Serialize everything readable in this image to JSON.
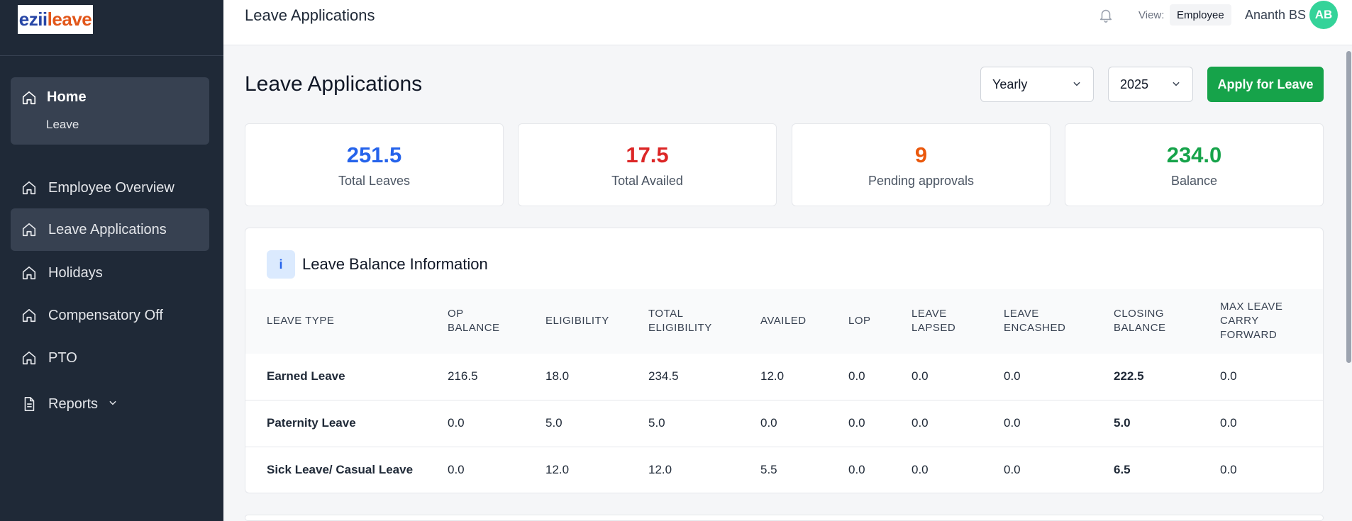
{
  "brand": {
    "logo_part1": "ezii",
    "logo_part2": "leave"
  },
  "sidebar": {
    "home": {
      "label": "Home",
      "sub": "Leave"
    },
    "items": [
      {
        "label": "Employee Overview",
        "icon": "home-icon"
      },
      {
        "label": "Leave Applications",
        "icon": "home-icon",
        "active": true
      },
      {
        "label": "Holidays",
        "icon": "home-icon"
      },
      {
        "label": "Compensatory Off",
        "icon": "home-icon"
      },
      {
        "label": "PTO",
        "icon": "home-icon"
      },
      {
        "label": "Reports",
        "icon": "document-icon"
      }
    ]
  },
  "topbar": {
    "title": "Leave Applications",
    "view_label": "View:",
    "view_value": "Employee",
    "user_name": "Ananth BS",
    "avatar_initials": "AB"
  },
  "main": {
    "title": "Leave Applications",
    "period_select": "Yearly",
    "year_select": "2025",
    "apply_button": "Apply for Leave"
  },
  "stats": [
    {
      "value": "251.5",
      "label": "Total Leaves",
      "color": "#2563eb"
    },
    {
      "value": "17.5",
      "label": "Total Availed",
      "color": "#dc2626"
    },
    {
      "value": "9",
      "label": "Pending approvals",
      "color": "#ea580c"
    },
    {
      "value": "234.0",
      "label": "Balance",
      "color": "#16a34a"
    }
  ],
  "balance": {
    "icon_text": "i",
    "title": "Leave Balance Information",
    "headers": {
      "leave_type": "Leave Type",
      "op_balance": "OP Balance",
      "eligibility": "Eligibility",
      "total_eligibility": "Total Eligibility",
      "availed": "Availed",
      "lop": "LOP",
      "leave_lapsed": "Leave Lapsed",
      "leave_encashed": "Leave Encashed",
      "closing_balance": "Closing Balance",
      "max_carry_forward": "Max Leave Carry Forward"
    },
    "rows": [
      [
        "Earned Leave",
        "216.5",
        "18.0",
        "234.5",
        "12.0",
        "0.0",
        "0.0",
        "0.0",
        "222.5",
        "0.0"
      ],
      [
        "Paternity Leave",
        "0.0",
        "5.0",
        "5.0",
        "0.0",
        "0.0",
        "0.0",
        "0.0",
        "5.0",
        "0.0"
      ],
      [
        "Sick Leave/ Casual Leave",
        "0.0",
        "12.0",
        "12.0",
        "5.5",
        "0.0",
        "0.0",
        "0.0",
        "6.5",
        "0.0"
      ]
    ]
  }
}
